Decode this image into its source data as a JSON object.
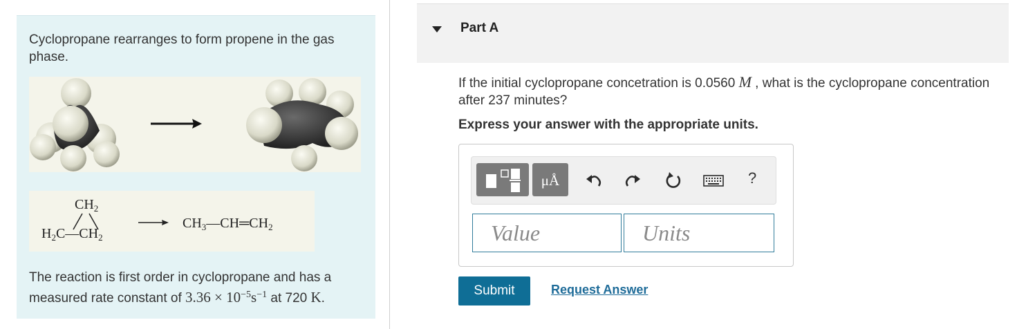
{
  "problem": {
    "intro": "Cyclopropane rearranges to form propene in the gas phase.",
    "reaction": {
      "reactant_top": "CH",
      "reactant_top_sub": "2",
      "reactant_left": "H",
      "reactant_left_sub": "2",
      "reactant_left_c": "C",
      "reactant_bond": "—",
      "reactant_right": "CH",
      "reactant_right_sub": "2",
      "product_1": "CH",
      "product_1_sub": "3",
      "product_bond1": "—",
      "product_2": "CH",
      "product_bond2": "═",
      "product_3": "CH",
      "product_3_sub": "2"
    },
    "description_prefix": "The reaction is first order in cyclopropane and has a measured rate constant of ",
    "rate_value": "3.36 × 10",
    "rate_exp": "−5",
    "rate_unit": "s",
    "rate_unit_exp": "−1",
    "description_mid": " at 720 ",
    "temp_unit": "K",
    "description_end": "."
  },
  "part": {
    "title": "Part A",
    "question_prefix": "If the initial cyclopropane concetration is 0.0560 ",
    "question_unit": "M",
    "question_suffix": " , what is the cyclopropane concentration after 237 minutes?",
    "instruction": "Express your answer with the appropriate units."
  },
  "toolbar": {
    "mu_label": "μÅ",
    "help_label": "?",
    "icons": [
      "templates-icon",
      "units-icon",
      "undo-icon",
      "redo-icon",
      "reset-icon",
      "keyboard-icon",
      "help-icon"
    ]
  },
  "answer": {
    "value_placeholder": "Value",
    "units_placeholder": "Units"
  },
  "actions": {
    "submit_label": "Submit",
    "request_label": "Request Answer"
  },
  "colors": {
    "panel_bg": "#e4f3f5",
    "accent": "#0f6e96",
    "link": "#1f6c99",
    "tool_dark": "#7a7a7a"
  }
}
